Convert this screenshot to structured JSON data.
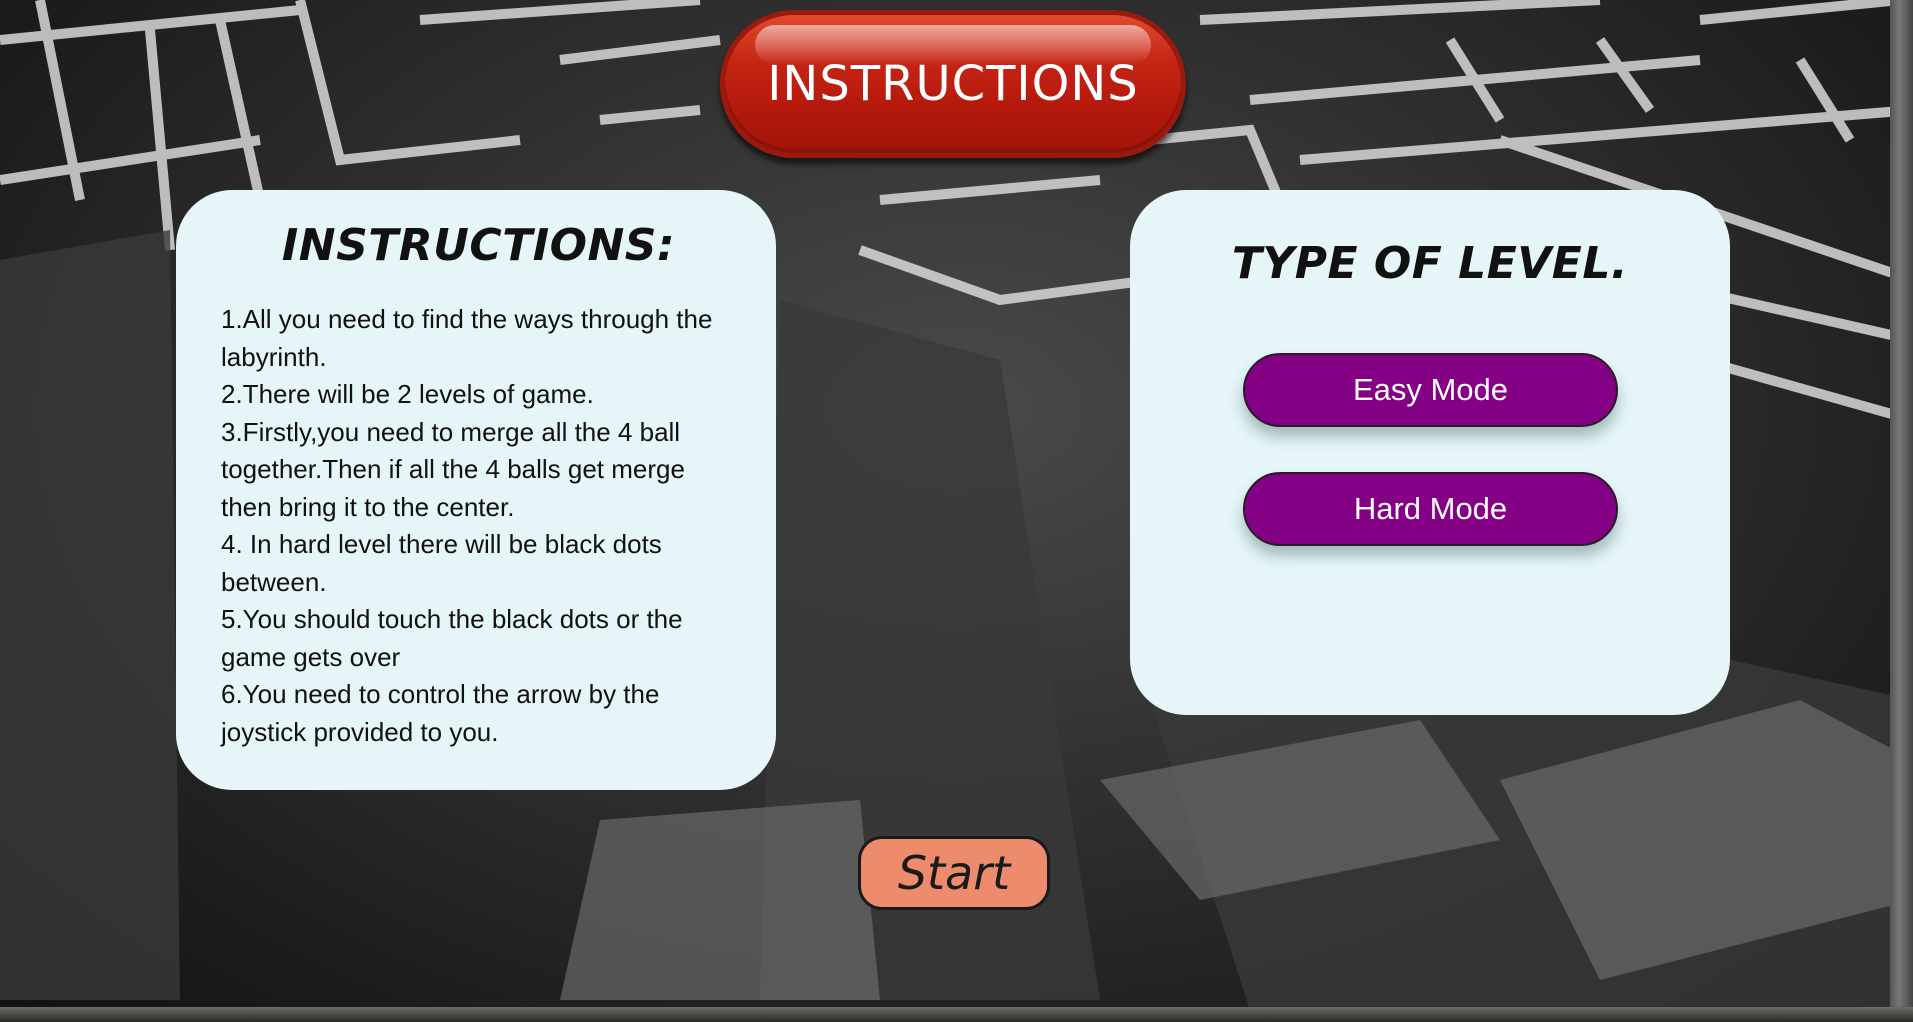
{
  "header": {
    "title": "INSTRUCTIONS"
  },
  "instructions_card": {
    "heading": "INSTRUCTIONS:",
    "items": [
      "1.All you need to find the ways through the labyrinth.",
      "2.There will be 2 levels of game.",
      "3.Firstly,you need to merge all the 4 ball together.Then if all the 4 balls get merge then bring it to the center.",
      "4. In hard level there will be black dots between.",
      "5.You should touch the black dots or the game gets over",
      "6.You need to control the arrow by the joystick provided to you."
    ]
  },
  "level_card": {
    "heading": "TYPE OF LEVEL.",
    "easy_label": "Easy Mode",
    "hard_label": "Hard Mode"
  },
  "start_label": "Start",
  "colors": {
    "title_pill": "#c42414",
    "card_bg": "#e6f6f8",
    "mode_button": "#840084",
    "start_button": "#ec8c6c"
  },
  "background": "maze-background-image"
}
